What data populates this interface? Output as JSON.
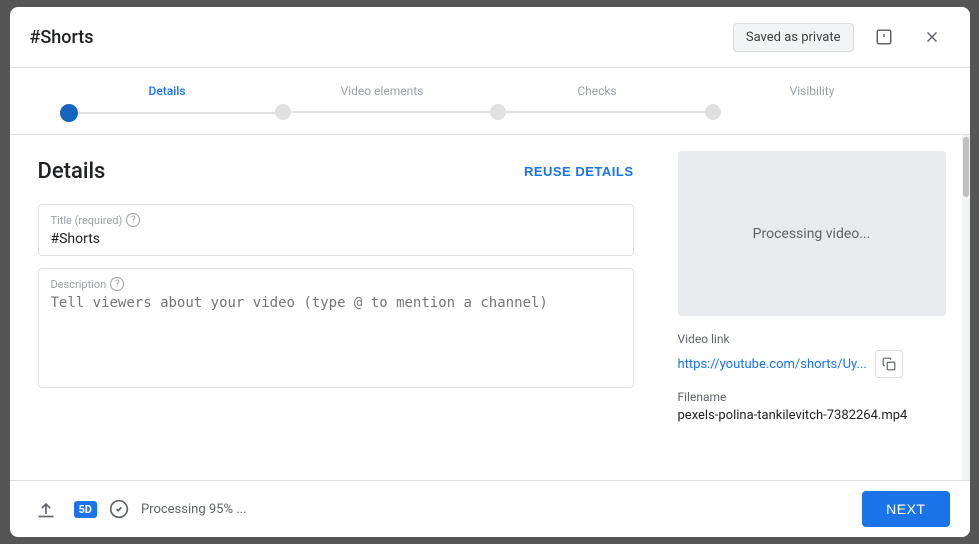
{
  "modal": {
    "title": "#Shorts",
    "saved_badge": "Saved as private",
    "alert_icon": "!",
    "close_icon": "✕"
  },
  "stepper": {
    "steps": [
      {
        "label": "Details",
        "active": true
      },
      {
        "label": "Video elements",
        "active": false
      },
      {
        "label": "Checks",
        "active": false
      },
      {
        "label": "Visibility",
        "active": false
      }
    ]
  },
  "details": {
    "section_title": "Details",
    "reuse_label": "REUSE DETAILS",
    "title_field": {
      "label": "Title (required)",
      "value": "#Shorts",
      "placeholder": ""
    },
    "description_field": {
      "label": "Description",
      "placeholder": "Tell viewers about your video (type @ to mention a channel)"
    }
  },
  "right_panel": {
    "processing_text": "Processing video...",
    "video_link_label": "Video link",
    "video_link_text": "https://youtube.com/shorts/Uy...",
    "video_link_full": "https://youtube.com/shorts/Uy...",
    "filename_label": "Filename",
    "filename_value": "pexels-polina-tankilevitch-7382264.mp4"
  },
  "footer": {
    "sd_badge": "5D",
    "processing_status": "Processing 95% ...",
    "next_label": "NEXT"
  }
}
